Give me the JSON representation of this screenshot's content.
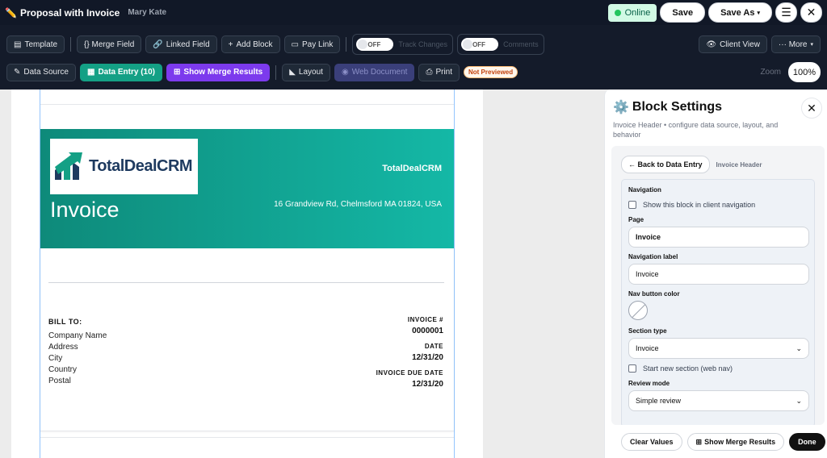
{
  "app": {
    "doc_title": "Proposal with Invoice",
    "doc_owner": "Mary Kate",
    "status": "Online",
    "save_label": "Save",
    "save_as_label": "Save As",
    "save_as_caret": "▾"
  },
  "toolbar": {
    "template": "Template",
    "merge_field": "{} Merge Field",
    "linked_field": "Linked Field",
    "add_block": "Add Block",
    "pay_link": "Pay Link",
    "track_changes_state": "OFF",
    "track_changes_label": "Track Changes",
    "comments_state": "OFF",
    "comments_label": "Comments",
    "client_view": "Client View",
    "more": "··· More",
    "more_caret": "▾",
    "data_source": "Data Source",
    "data_entry": "Data Entry (10)",
    "show_merge_results": "Show Merge Results",
    "layout": "Layout",
    "web_document": "Web Document",
    "print": "Print",
    "preview_badge": "Not Previewed",
    "zoom_label": "Zoom",
    "zoom_value": "100%"
  },
  "invoice": {
    "logo_text": "TotalDealCRM",
    "title": "Invoice",
    "company": "TotalDealCRM",
    "address": "16 Grandview Rd, Chelmsford MA 01824, USA",
    "bill_to_label": "BILL TO:",
    "bill_to_lines": [
      "Company Name",
      "Address",
      "City",
      "Country",
      "Postal"
    ],
    "invoice_no_label": "INVOICE #",
    "invoice_no": "0000001",
    "date_label": "DATE",
    "date": "12/31/20",
    "due_label": "INVOICE DUE DATE",
    "due_date": "12/31/20"
  },
  "panel": {
    "title": "Block Settings",
    "subtitle": "Invoice Header • configure data source, layout, and behavior",
    "back_label": "← Back to Data Entry",
    "crumb": "Invoice Header",
    "navigation_label": "Navigation",
    "show_in_nav": "Show this block in client navigation",
    "page_label": "Page",
    "page_value": "Invoice",
    "nav_label_label": "Navigation label",
    "nav_label_value": "Invoice",
    "nav_color_label": "Nav button color",
    "section_type_label": "Section type",
    "section_type_value": "Invoice",
    "start_new_section": "Start new section (web nav)",
    "review_mode_label": "Review mode",
    "review_mode_value": "Simple review",
    "clear_values": "Clear Values",
    "show_merge_results": "Show Merge Results",
    "done": "Done"
  },
  "colors": {
    "header_teal_start": "#0e8a7a",
    "header_teal_end": "#14b8a6",
    "accent_purple": "#7c3aed",
    "online_green": "#22c55e"
  }
}
